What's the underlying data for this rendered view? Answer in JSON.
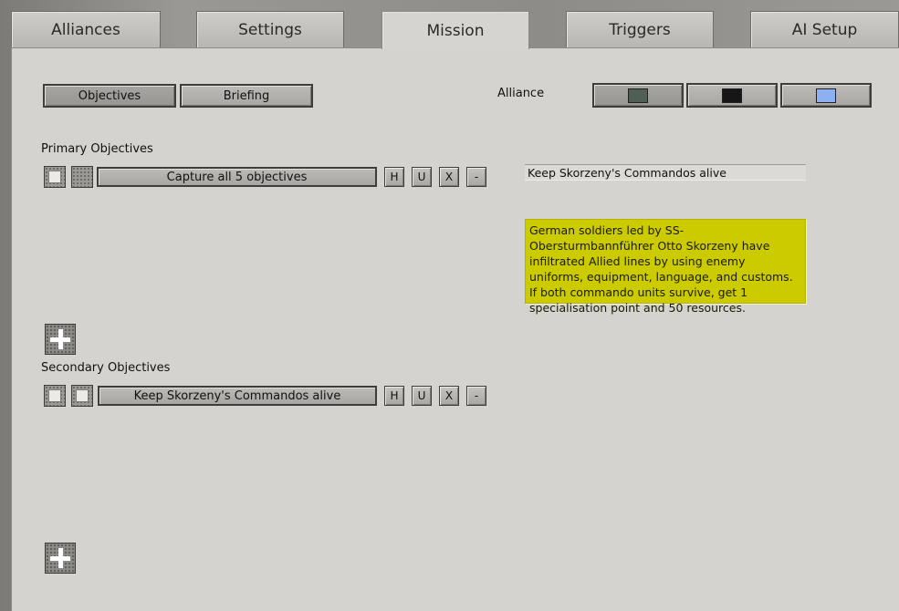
{
  "tabs": [
    {
      "label": "Alliances"
    },
    {
      "label": "Settings"
    },
    {
      "label": "Mission"
    },
    {
      "label": "Triggers"
    },
    {
      "label": "AI Setup"
    }
  ],
  "active_tab": "Mission",
  "subtabs": {
    "objectives_label": "Objectives",
    "briefing_label": "Briefing",
    "selected": "Objectives"
  },
  "alliance": {
    "label": "Alliance",
    "swatches": [
      {
        "color": "#4f5f54",
        "selected": true
      },
      {
        "color": "#161616",
        "selected": false
      },
      {
        "color": "#8db0f2",
        "selected": false
      }
    ]
  },
  "primary": {
    "heading": "Primary Objectives",
    "objectives": [
      {
        "text": "Capture all 5 objectives"
      }
    ]
  },
  "secondary": {
    "heading": "Secondary Objectives",
    "objectives": [
      {
        "text": "Keep Skorzeny's Commandos alive"
      }
    ]
  },
  "row_buttons": {
    "h": "H",
    "u": "U",
    "x": "X",
    "minus": "-"
  },
  "detail": {
    "title": "Keep Skorzeny's Commandos alive",
    "description": "German soldiers led by SS-Obersturmbannführer Otto Skorzeny have infiltrated Allied lines by using enemy uniforms, equipment, language, and customs. If both commando units survive, get 1 specialisation point and 50 resources.",
    "highlight_color": "#cccb00"
  }
}
